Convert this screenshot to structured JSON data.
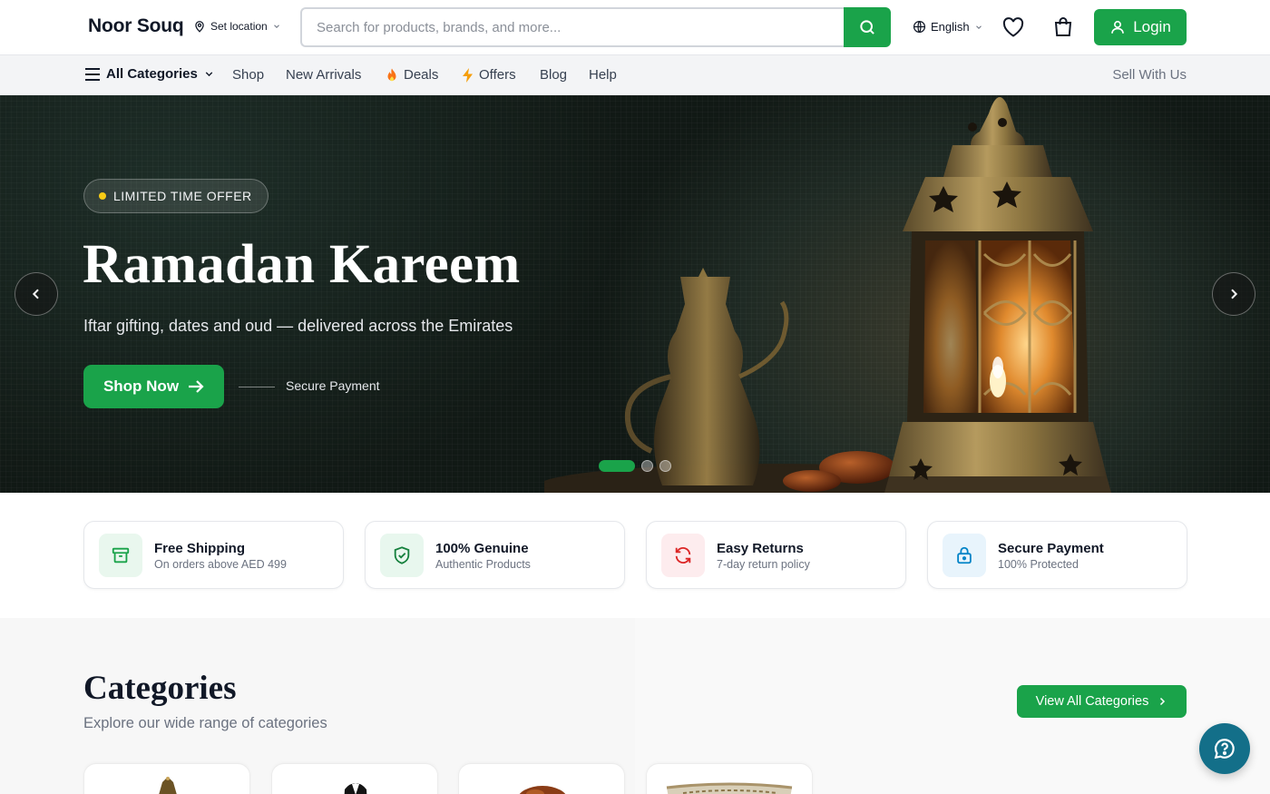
{
  "header": {
    "logo": "Noor Souq",
    "location_label": "Set location",
    "search_placeholder": "Search for products, brands, and more...",
    "language": "English",
    "login_label": "Login"
  },
  "nav": {
    "all_categories": "All Categories",
    "items": [
      "Shop",
      "New Arrivals",
      "Deals",
      "Offers",
      "Blog",
      "Help"
    ],
    "sell_label": "Sell With Us"
  },
  "hero": {
    "badge": "LIMITED TIME OFFER",
    "title": "Ramadan Kareem",
    "subtitle": "Iftar gifting, dates and oud — delivered across the Emirates",
    "cta": "Shop Now",
    "secure_label": "Secure Payment",
    "slide_count": 3,
    "active_slide": 1
  },
  "features": [
    {
      "title": "Free Shipping",
      "subtitle": "On orders above AED 499",
      "icon": "box-icon",
      "color": "#1aa34a"
    },
    {
      "title": "100% Genuine",
      "subtitle": "Authentic Products",
      "icon": "shield-check-icon",
      "color": "#15803d"
    },
    {
      "title": "Easy Returns",
      "subtitle": "7-day return policy",
      "icon": "refresh-icon",
      "color": "#dc2626"
    },
    {
      "title": "Secure Payment",
      "subtitle": "100% Protected",
      "icon": "lock-icon",
      "color": "#0284c7"
    }
  ],
  "categories": {
    "title": "Categories",
    "subtitle": "Explore our wide range of categories",
    "view_all": "View All Categories"
  },
  "colors": {
    "brand": "#1aa34a",
    "chat": "#136f89",
    "badge_dot": "#facc15"
  }
}
